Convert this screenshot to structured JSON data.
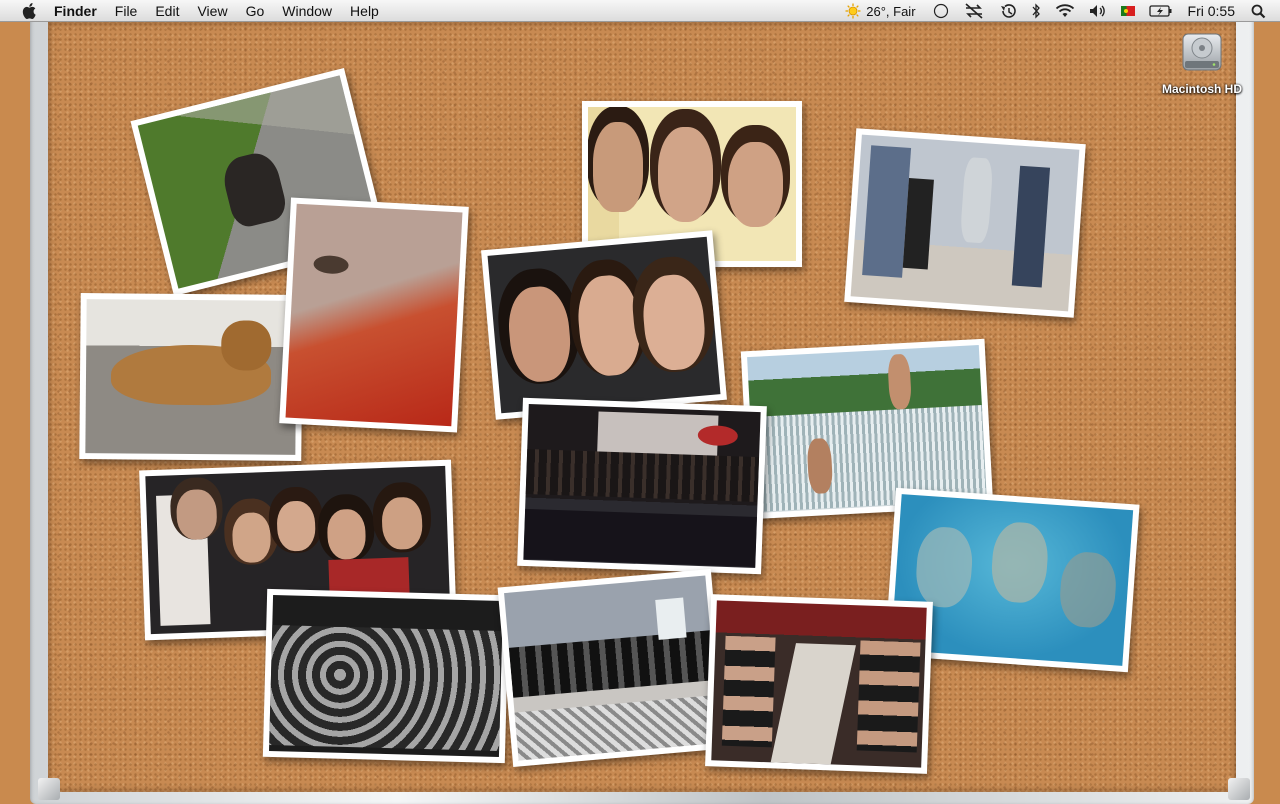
{
  "menubar": {
    "app_name": "Finder",
    "menus": [
      "File",
      "Edit",
      "View",
      "Go",
      "Window",
      "Help"
    ],
    "weather": "26°, Fair",
    "clock": "Fri 0:55",
    "extras_icons": [
      "weather-sun-icon",
      "circle-status-icon",
      "sync-disabled-icon",
      "time-machine-icon",
      "bluetooth-icon",
      "wifi-icon",
      "volume-icon",
      "portugal-flag-icon",
      "battery-charging-icon",
      "spotlight-search-icon"
    ]
  },
  "desktop": {
    "icons": [
      {
        "label": "Macintosh HD",
        "icon": "hard-drive-icon"
      }
    ]
  },
  "board": {
    "photos": [
      {
        "name": "photo-small-dog"
      },
      {
        "name": "photo-lying-dog"
      },
      {
        "name": "photo-cat-closeup"
      },
      {
        "name": "photo-three-girls"
      },
      {
        "name": "photo-three-friends-selfie"
      },
      {
        "name": "photo-jumping-on-bed"
      },
      {
        "name": "photo-waterfall-jump"
      },
      {
        "name": "photo-stage-choir"
      },
      {
        "name": "photo-underwater-swim"
      },
      {
        "name": "photo-group-party"
      },
      {
        "name": "photo-black-white-group"
      },
      {
        "name": "photo-street-procession"
      },
      {
        "name": "photo-restaurant-dinner"
      }
    ]
  },
  "colors": {
    "cork": "#c88a52",
    "frame": "#e6e9eb",
    "menubar": "#ececec"
  }
}
